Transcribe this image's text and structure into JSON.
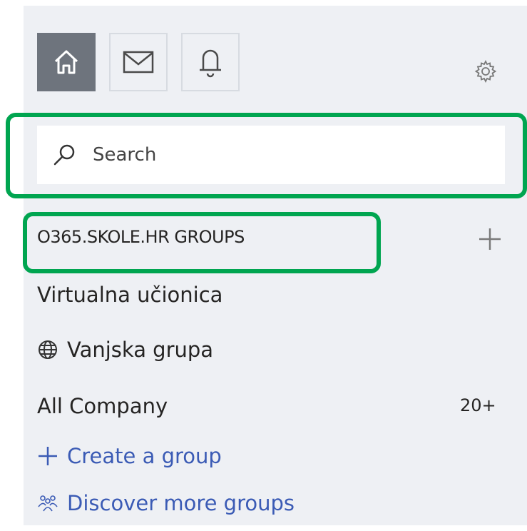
{
  "search": {
    "placeholder": "Search"
  },
  "groups": {
    "header": "O365.SKOLE.HR GROUPS",
    "items": [
      {
        "label": "Virtualna učionica"
      },
      {
        "label": "Vanjska grupa",
        "icon": "globe-icon"
      },
      {
        "label": "All Company",
        "count": "20+"
      }
    ],
    "create_label": "Create a group",
    "discover_label": "Discover more groups"
  },
  "nav": {
    "icons": [
      "home-icon",
      "mail-icon",
      "bell-icon",
      "gear-icon"
    ]
  },
  "colors": {
    "panel_bg": "#eef0f4",
    "active_nav": "#6e747d",
    "highlight": "#00a550",
    "link": "#3b5bb5"
  }
}
